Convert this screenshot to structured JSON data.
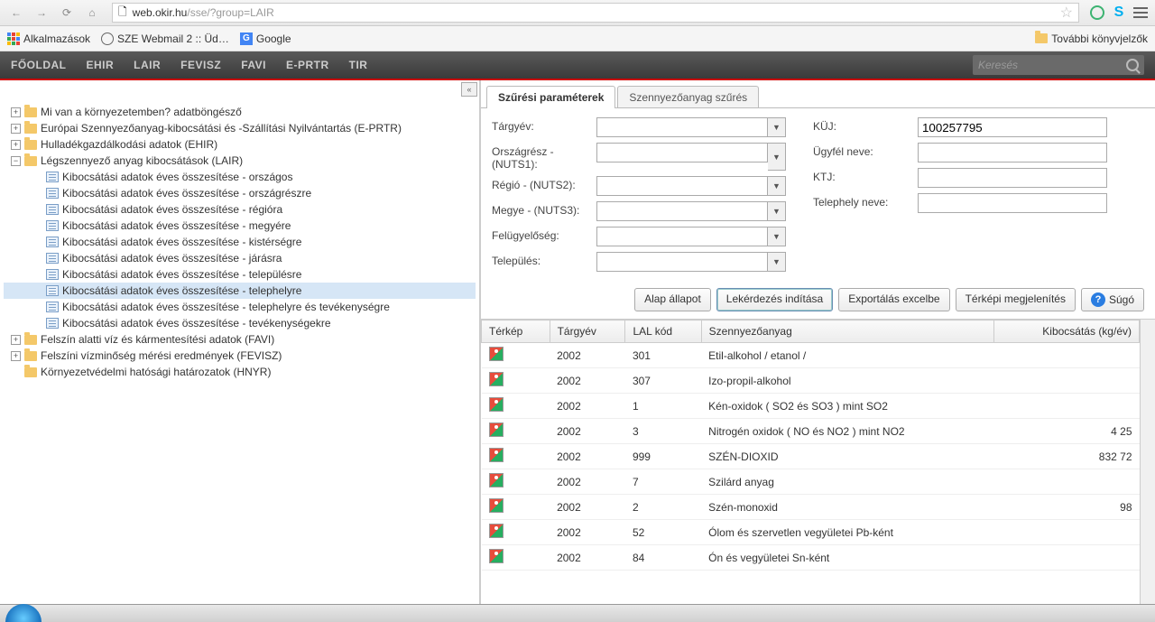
{
  "browser": {
    "url_host": "web.okir.hu",
    "url_path": "/sse/?group=LAIR",
    "bookmarks": {
      "apps": "Alkalmazások",
      "webmail": "SZE Webmail 2 :: Üd…",
      "google": "Google",
      "more": "További könyvjelzők"
    }
  },
  "nav": {
    "items": [
      "FŐOLDAL",
      "EHIR",
      "LAIR",
      "FEVISZ",
      "FAVI",
      "E-PRTR",
      "TIR"
    ],
    "search_placeholder": "Keresés"
  },
  "tree": {
    "r0": "Mi van a környezetemben? adatböngésző",
    "r1": "Európai Szennyezőanyag-kibocsátási és -Szállítási Nyilvántartás (E-PRTR)",
    "r2": "Hulladékgazdálkodási adatok (EHIR)",
    "r3": "Légszennyező anyag kibocsátások (LAIR)",
    "r3c": [
      "Kibocsátási adatok éves összesítése - országos",
      "Kibocsátási adatok éves összesítése - országrészre",
      "Kibocsátási adatok éves összesítése - régióra",
      "Kibocsátási adatok éves összesítése - megyére",
      "Kibocsátási adatok éves összesítése - kistérségre",
      "Kibocsátási adatok éves összesítése - járásra",
      "Kibocsátási adatok éves összesítése - településre",
      "Kibocsátási adatok éves összesítése - telephelyre",
      "Kibocsátási adatok éves összesítése - telephelyre és tevékenységre",
      "Kibocsátási adatok éves összesítése - tevékenységekre"
    ],
    "r4": "Felszín alatti víz és kármentesítési adatok (FAVI)",
    "r5": "Felszíni vízminőség mérési eredmények (FEVISZ)",
    "r6": "Környezetvédelmi hatósági határozatok (HNYR)"
  },
  "tabs": {
    "t0": "Szűrési paraméterek",
    "t1": "Szennyezőanyag szűrés"
  },
  "filters": {
    "l0": "Tárgyév:",
    "l1": "Országrész - (NUTS1):",
    "l2": "Régió - (NUTS2):",
    "l3": "Megye - (NUTS3):",
    "l4": "Felügyelőség:",
    "l5": "Település:",
    "r0": "KÜJ:",
    "r1": "Ügyfél neve:",
    "r2": "KTJ:",
    "r3": "Telephely neve:",
    "kuj_value": "100257795"
  },
  "buttons": {
    "reset": "Alap állapot",
    "query": "Lekérdezés indítása",
    "export": "Exportálás excelbe",
    "map": "Térképi megjelenítés",
    "help": "Súgó"
  },
  "grid": {
    "headers": {
      "h0": "Térkép",
      "h1": "Tárgyév",
      "h2": "LAL kód",
      "h3": "Szennyezőanyag",
      "h4": "Kibocsátás (kg/év)"
    },
    "rows": [
      {
        "year": "2002",
        "code": "301",
        "name": "Etil-alkohol / etanol /",
        "val": ""
      },
      {
        "year": "2002",
        "code": "307",
        "name": "Izo-propil-alkohol",
        "val": ""
      },
      {
        "year": "2002",
        "code": "1",
        "name": "Kén-oxidok ( SO2 és SO3 ) mint SO2",
        "val": ""
      },
      {
        "year": "2002",
        "code": "3",
        "name": "Nitrogén oxidok ( NO és NO2 ) mint NO2",
        "val": "4 25"
      },
      {
        "year": "2002",
        "code": "999",
        "name": "SZÉN-DIOXID",
        "val": "832 72"
      },
      {
        "year": "2002",
        "code": "7",
        "name": "Szilárd anyag",
        "val": ""
      },
      {
        "year": "2002",
        "code": "2",
        "name": "Szén-monoxid",
        "val": "98"
      },
      {
        "year": "2002",
        "code": "52",
        "name": "Ólom és szervetlen vegyületei Pb-ként",
        "val": ""
      },
      {
        "year": "2002",
        "code": "84",
        "name": "Ón és vegyületei Sn-ként",
        "val": ""
      }
    ]
  }
}
